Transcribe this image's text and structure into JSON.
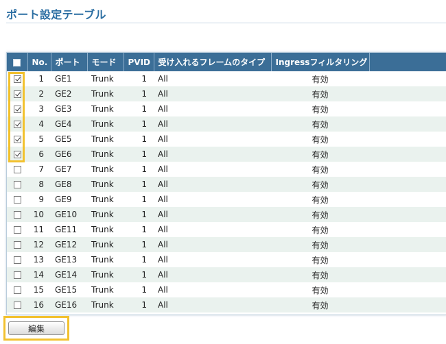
{
  "page": {
    "title": "ポート設定テーブル"
  },
  "table": {
    "headers": {
      "no": "No.",
      "port": "ポート",
      "mode": "モード",
      "pvid": "PVID",
      "accepted_frames": "受け入れるフレームのタイプ",
      "ingress": "Ingressフィルタリング"
    },
    "rows": [
      {
        "checked": true,
        "no": "1",
        "port": "GE1",
        "mode": "Trunk",
        "pvid": "1",
        "accepted": "All",
        "ingress": "有効"
      },
      {
        "checked": true,
        "no": "2",
        "port": "GE2",
        "mode": "Trunk",
        "pvid": "1",
        "accepted": "All",
        "ingress": "有効"
      },
      {
        "checked": true,
        "no": "3",
        "port": "GE3",
        "mode": "Trunk",
        "pvid": "1",
        "accepted": "All",
        "ingress": "有効"
      },
      {
        "checked": true,
        "no": "4",
        "port": "GE4",
        "mode": "Trunk",
        "pvid": "1",
        "accepted": "All",
        "ingress": "有効"
      },
      {
        "checked": true,
        "no": "5",
        "port": "GE5",
        "mode": "Trunk",
        "pvid": "1",
        "accepted": "All",
        "ingress": "有効"
      },
      {
        "checked": true,
        "no": "6",
        "port": "GE6",
        "mode": "Trunk",
        "pvid": "1",
        "accepted": "All",
        "ingress": "有効"
      },
      {
        "checked": false,
        "no": "7",
        "port": "GE7",
        "mode": "Trunk",
        "pvid": "1",
        "accepted": "All",
        "ingress": "有効"
      },
      {
        "checked": false,
        "no": "8",
        "port": "GE8",
        "mode": "Trunk",
        "pvid": "1",
        "accepted": "All",
        "ingress": "有効"
      },
      {
        "checked": false,
        "no": "9",
        "port": "GE9",
        "mode": "Trunk",
        "pvid": "1",
        "accepted": "All",
        "ingress": "有効"
      },
      {
        "checked": false,
        "no": "10",
        "port": "GE10",
        "mode": "Trunk",
        "pvid": "1",
        "accepted": "All",
        "ingress": "有効"
      },
      {
        "checked": false,
        "no": "11",
        "port": "GE11",
        "mode": "Trunk",
        "pvid": "1",
        "accepted": "All",
        "ingress": "有効"
      },
      {
        "checked": false,
        "no": "12",
        "port": "GE12",
        "mode": "Trunk",
        "pvid": "1",
        "accepted": "All",
        "ingress": "有効"
      },
      {
        "checked": false,
        "no": "13",
        "port": "GE13",
        "mode": "Trunk",
        "pvid": "1",
        "accepted": "All",
        "ingress": "有効"
      },
      {
        "checked": false,
        "no": "14",
        "port": "GE14",
        "mode": "Trunk",
        "pvid": "1",
        "accepted": "All",
        "ingress": "有効"
      },
      {
        "checked": false,
        "no": "15",
        "port": "GE15",
        "mode": "Trunk",
        "pvid": "1",
        "accepted": "All",
        "ingress": "有効"
      },
      {
        "checked": false,
        "no": "16",
        "port": "GE16",
        "mode": "Trunk",
        "pvid": "1",
        "accepted": "All",
        "ingress": "有効"
      }
    ]
  },
  "actions": {
    "edit_label": "編集"
  },
  "colors": {
    "title": "#2d6fa3",
    "header_bg": "#3b6e97",
    "row_alt": "#eaf2ee",
    "highlight": "#f2c12e"
  }
}
